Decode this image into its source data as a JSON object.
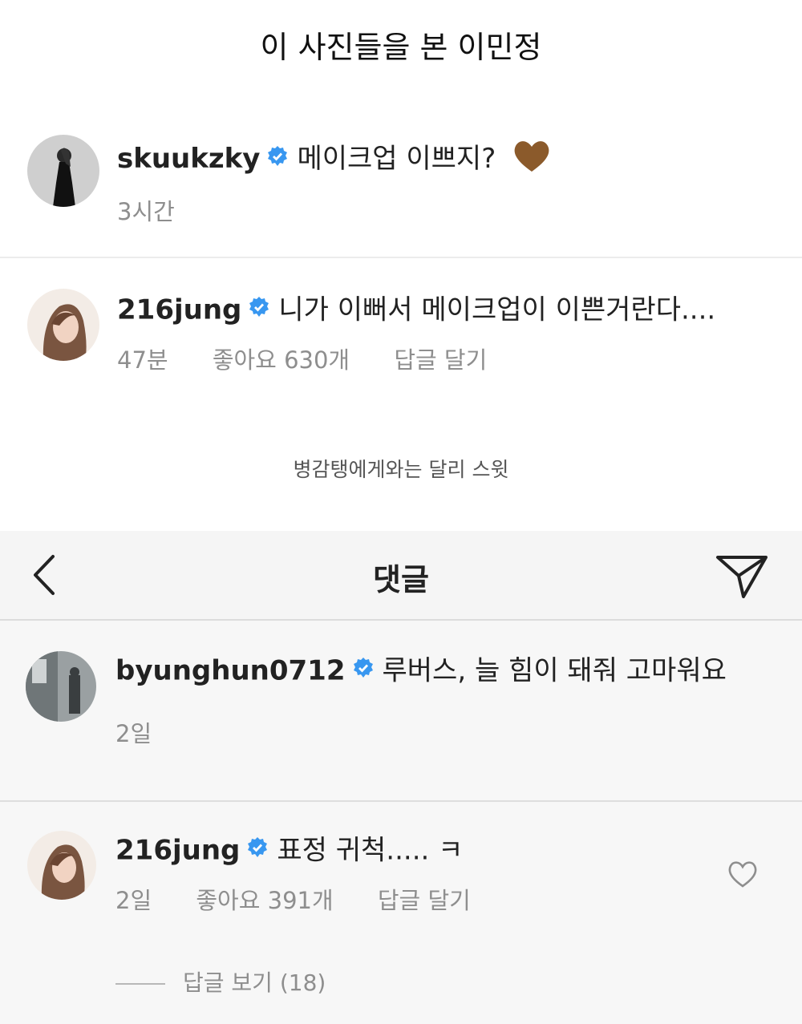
{
  "title": "이 사진들을 본 이민정",
  "top_comments": [
    {
      "username": "skuukzky",
      "text": "메이크업 이쁘지?",
      "emoji": "🤎",
      "time": "3시간"
    },
    {
      "username": "216jung",
      "text": "니가 이뻐서 메이크업이 이쁜거란다....",
      "time": "47분",
      "likes": "좋아요 630개",
      "reply": "답글 달기"
    }
  ],
  "caption": "병감탱에게와는 달리 스윗",
  "comments_header": {
    "title": "댓글",
    "back_icon": "chevron-left-icon",
    "send_icon": "paper-plane-icon"
  },
  "bottom_comments": [
    {
      "username": "byunghun0712",
      "text": "루버스, 늘 힘이 돼줘 고마워요",
      "time": "2일"
    },
    {
      "username": "216jung",
      "text": "표정 귀척..... ㅋ",
      "time": "2일",
      "likes": "좋아요 391개",
      "reply": "답글 달기"
    }
  ],
  "view_replies": "답글 보기 (18)",
  "colors": {
    "verified": "#3897f0",
    "meta_gray": "#8e8e8e",
    "heart_brown": "#8b5a2b"
  }
}
